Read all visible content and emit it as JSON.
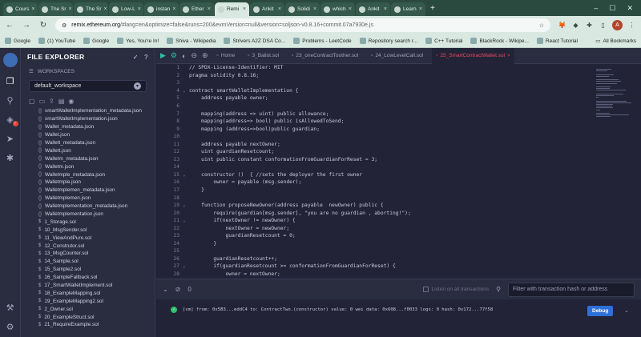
{
  "browser": {
    "tabs": [
      {
        "label": "Cours",
        "active": false
      },
      {
        "label": "The Sr",
        "active": false
      },
      {
        "label": "The Sr",
        "active": false
      },
      {
        "label": "Low-L",
        "active": false
      },
      {
        "label": "instan",
        "active": false
      },
      {
        "label": "Ether",
        "active": false
      },
      {
        "label": "Remi",
        "active": true
      },
      {
        "label": "Ankit",
        "active": false
      },
      {
        "label": "Solidi",
        "active": false
      },
      {
        "label": "which",
        "active": false
      },
      {
        "label": "Ankit",
        "active": false
      },
      {
        "label": "Learn",
        "active": false
      }
    ],
    "url_host": "remix.ethereum.org",
    "url_path": "/#lang=en&optimize=false&runs=200&evmVersion=null&version=soljson-v0.8.16+commit.07a7930e.js",
    "avatar_letter": "A",
    "bookmarks": [
      "Google",
      "(1) YouTube",
      "Google",
      "Yes, You're In!",
      "Shiva - Wikipedia",
      "Strivers A2Z DSA Co...",
      "Problems - LeetCode",
      "Repository search r...",
      "C++ Tutorial",
      "BlackRock - Wikipe...",
      "React Tutorial"
    ],
    "all_bookmarks": "All Bookmarks"
  },
  "explorer": {
    "title": "FILE EXPLORER",
    "workspaces_label": "WORKSPACES",
    "workspace": "default_workspace",
    "files": [
      {
        "name": "smartWalletImplementation_metadata.json",
        "type": "json"
      },
      {
        "name": "smartWalletImplementation.json",
        "type": "json"
      },
      {
        "name": "Wallet_metadata.json",
        "type": "json"
      },
      {
        "name": "Wallet.json",
        "type": "json"
      },
      {
        "name": "Wallett_metadata.json",
        "type": "json"
      },
      {
        "name": "Wallett.json",
        "type": "json"
      },
      {
        "name": "Walletm_metadata.json",
        "type": "json"
      },
      {
        "name": "Walletm.json",
        "type": "json"
      },
      {
        "name": "Walletmple_metadata.json",
        "type": "json"
      },
      {
        "name": "Walletmple.json",
        "type": "json"
      },
      {
        "name": "Walletmplemen_metadata.json",
        "type": "json"
      },
      {
        "name": "Walletmplemen.json",
        "type": "json"
      },
      {
        "name": "Walletmplementation_metadata.json",
        "type": "json"
      },
      {
        "name": "Walletmplementation.json",
        "type": "json"
      },
      {
        "name": "1_Storage.sol",
        "type": "sol"
      },
      {
        "name": "10_MsgSender.sol",
        "type": "sol"
      },
      {
        "name": "11_ViewAndPure.sol",
        "type": "sol"
      },
      {
        "name": "12_Construtor.sol",
        "type": "sol"
      },
      {
        "name": "13_MsgCounter.sol",
        "type": "sol"
      },
      {
        "name": "14_Sample.sol",
        "type": "sol"
      },
      {
        "name": "15_Sample2.sol",
        "type": "sol"
      },
      {
        "name": "16_SampleFallback.sol",
        "type": "sol"
      },
      {
        "name": "17_SmartWalletImplement.sol",
        "type": "sol"
      },
      {
        "name": "18_ExampleMapping.sol",
        "type": "sol"
      },
      {
        "name": "19_ExampleMapping2.sol",
        "type": "sol"
      },
      {
        "name": "2_Owner.sol",
        "type": "sol"
      },
      {
        "name": "20_ExampleStruct.sol",
        "type": "sol"
      },
      {
        "name": "21_RequireExample.sol",
        "type": "sol"
      }
    ]
  },
  "editor": {
    "tabs": [
      {
        "label": "Home",
        "active": false
      },
      {
        "label": "3_Ballot.sol",
        "active": false
      },
      {
        "label": "23_oneContractToother.sol",
        "active": false
      },
      {
        "label": "24_LowLevelCall.sol",
        "active": false
      },
      {
        "label": "25_SmartContractWallet.sol",
        "active": true
      }
    ],
    "lines": [
      {
        "n": "1",
        "fold": "",
        "code": "// SPDX-License-Identifier: MIT"
      },
      {
        "n": "2",
        "fold": "",
        "code": "pragma solidity 0.8.16;"
      },
      {
        "n": "3",
        "fold": "",
        "code": ""
      },
      {
        "n": "4",
        "fold": "v",
        "code": "contract smartWalletImplementation {"
      },
      {
        "n": "5",
        "fold": "",
        "code": "    address payable owner;"
      },
      {
        "n": "6",
        "fold": "",
        "code": ""
      },
      {
        "n": "7",
        "fold": "",
        "code": "    mapping(address => uint) public allowance;"
      },
      {
        "n": "8",
        "fold": "",
        "code": "    mapping(address=> bool) public isAllowedToSend;"
      },
      {
        "n": "9",
        "fold": "",
        "code": "    mapping (address=>bool)public guardian;"
      },
      {
        "n": "10",
        "fold": "",
        "code": ""
      },
      {
        "n": "11",
        "fold": "",
        "code": "    address payable nextOwner;"
      },
      {
        "n": "12",
        "fold": "",
        "code": "    uint guardianResetcount;"
      },
      {
        "n": "13",
        "fold": "",
        "code": "    uint public constant conformationFromGuardianForReset = 3;"
      },
      {
        "n": "14",
        "fold": "",
        "code": ""
      },
      {
        "n": "15",
        "fold": "v",
        "code": "    constructor ()  { //sets the deployer the first owner"
      },
      {
        "n": "16",
        "fold": "",
        "code": "        owner = payable (msg.sender);"
      },
      {
        "n": "17",
        "fold": "",
        "code": "    }"
      },
      {
        "n": "18",
        "fold": "",
        "code": ""
      },
      {
        "n": "19",
        "fold": "v",
        "code": "    function proposeNewOwner(address payable  newOwner) public {"
      },
      {
        "n": "20",
        "fold": "",
        "code": "        require(guardian[msg.sender], \"you are no guardian , aborting!\");"
      },
      {
        "n": "21",
        "fold": "v",
        "code": "        if(nextOwner != newOwner) {"
      },
      {
        "n": "22",
        "fold": "",
        "code": "            nextOwner = newOwner;"
      },
      {
        "n": "23",
        "fold": "",
        "code": "            guardianResetcount = 0;"
      },
      {
        "n": "24",
        "fold": "",
        "code": "        }"
      },
      {
        "n": "25",
        "fold": "",
        "code": ""
      },
      {
        "n": "26",
        "fold": "",
        "code": "        guardianResetcount++;"
      },
      {
        "n": "27",
        "fold": "v",
        "code": "        if(guardianResetcount >= conformationFromGuardianForReset) {"
      },
      {
        "n": "28",
        "fold": "",
        "code": "            owner = nextOwner;"
      }
    ]
  },
  "terminal": {
    "listen_label": "Listen on all transactions",
    "filter_placeholder": "Filter with transaction hash or address",
    "log": "[vm] from: 0x5B3...eddC4 to: ContractTwo.(constructor) value: 0 wei data: 0x608...f0033 logs: 0 hash: 0x172...77f58",
    "debug_label": "Debug"
  },
  "colors": {
    "accent": "#2fbfa4",
    "active_tab": "#e84c62",
    "debug_button": "#2f6fd8"
  }
}
